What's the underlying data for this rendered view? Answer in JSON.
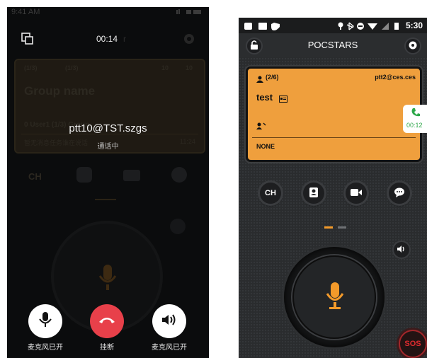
{
  "left": {
    "status_time": "9:41 AM",
    "call_timer": "00:14",
    "dim_title_fragment": "r",
    "dim_count_a": "(1/3)",
    "dim_count_b": "(1/3)",
    "dim_count_c": "10",
    "dim_count_d": "10",
    "dim_group_name": "Group  name",
    "dim_user": "0 User1 (1/3) Group",
    "dim_line": "暂无消息任务谁在说话",
    "dim_time": "11:24",
    "dim_ch": "CH",
    "caller": "ptt10@TST.szgs",
    "call_status": "通话中",
    "buttons": [
      {
        "label": "麦克风已开",
        "icon": "microphone-icon"
      },
      {
        "label": "挂断",
        "icon": "hangup-icon"
      },
      {
        "label": "麦克风已开",
        "icon": "speaker-icon"
      }
    ]
  },
  "right": {
    "status_time": "5:30",
    "app_title": "POCSTARS",
    "group_count": "(2/6)",
    "account": "ptt2@ces.ces",
    "group_name": "test",
    "speaker": "NONE",
    "call_badge_time": "00:12",
    "ch_label": "CH",
    "sos_label": "SOS",
    "card_color": "#ef9f3d",
    "accent_color": "#f39a2a"
  }
}
